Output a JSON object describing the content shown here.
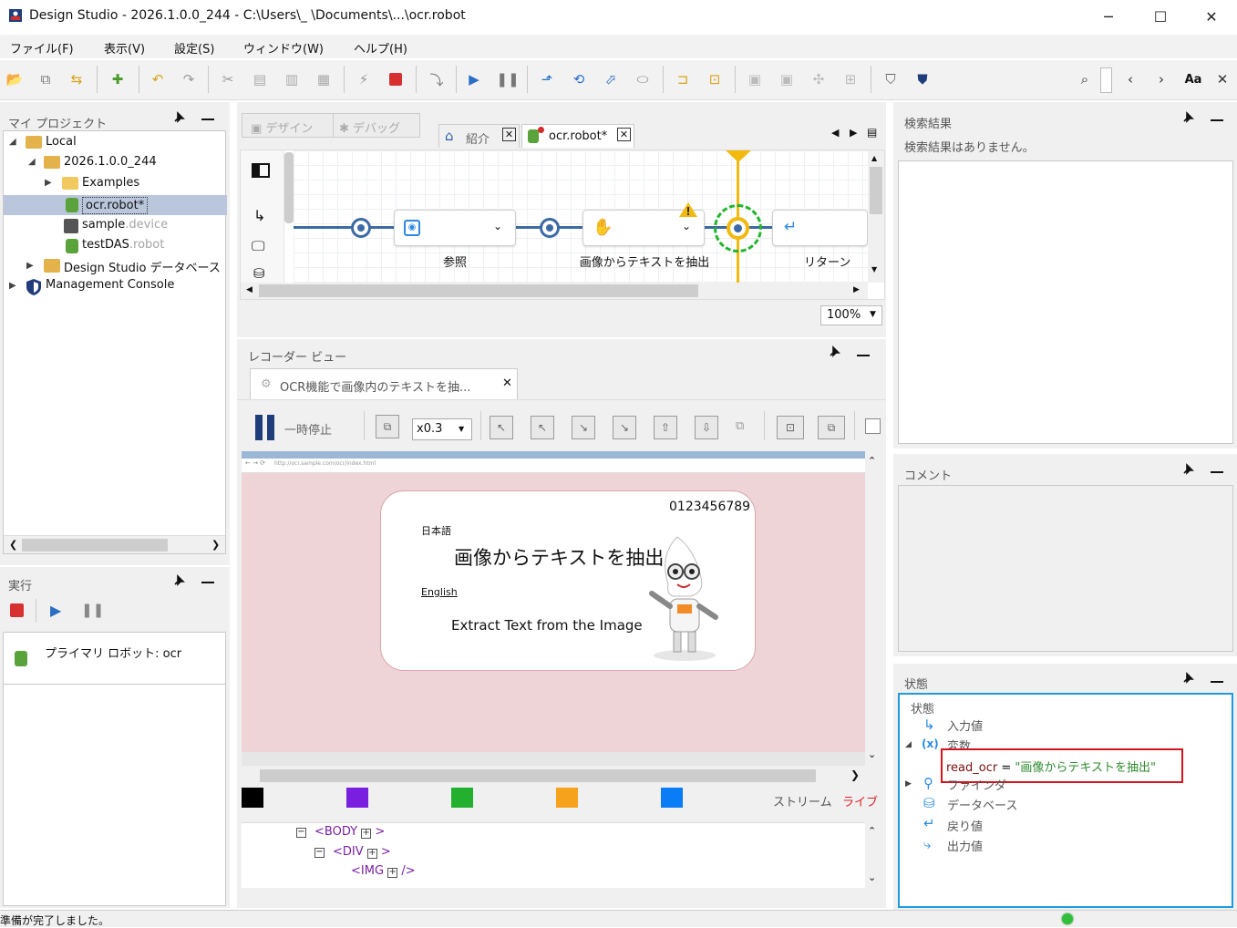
{
  "window": {
    "title": "Design Studio - 2026.1.0.0_244 - C:\\Users\\_        \\Documents\\...\\ocr.robot",
    "minimize": "─",
    "maximize": "☐",
    "close": "✕"
  },
  "menu": [
    "ファイル(F)",
    "表示(V)",
    "設定(S)",
    "ウィンドウ(W)",
    "ヘルプ(H)"
  ],
  "toolbar": {
    "search_value": "",
    "case_label": "Aa"
  },
  "project_panel": {
    "title": "マイ プロジェクト",
    "tree": {
      "local": "Local",
      "version": "2026.1.0.0_244",
      "examples": "Examples",
      "ocr_robot": "ocr.robot*",
      "sample": "sample",
      "sample_ext": ".device",
      "testdas": "testDAS",
      "testdas_ext": ".robot",
      "ds_db": "Design Studio データベース",
      "mc": "Management Console"
    }
  },
  "run_panel": {
    "title": "実行",
    "primary_robot": "プライマリ ロボット: ocr"
  },
  "editor": {
    "mode_tabs": [
      "デザイン",
      "デバッグ"
    ],
    "tabs": [
      "紹介",
      "ocr.robot*"
    ],
    "steps": [
      "参照",
      "画像からテキストを抽出",
      "リターン"
    ],
    "zoom": "100%"
  },
  "recorder": {
    "title": "レコーダー ビュー",
    "tab_label": "OCR機能で画像内のテキストを抽...",
    "pause_label": "一時停止",
    "speed": "x0.3",
    "url": "http://ocr.sample.com/ocr/index.html",
    "card": {
      "number": "0123456789",
      "jp_label": "日本語",
      "jp_text": "画像からテキストを抽出",
      "en_label": "English",
      "en_text": "Extract Text from the Image"
    },
    "stream_label": "ストリーム",
    "live_label": "ライブ",
    "swatches": [
      "#000000",
      "#7a1fe0",
      "#22b02e",
      "#f7a21c",
      "#0a7cf5"
    ],
    "xml": [
      "<BODY",
      ">",
      "<DIV",
      ">",
      "<IMG",
      "/>"
    ]
  },
  "search_panel": {
    "title": "検索結果",
    "empty": "検索結果はありません。"
  },
  "comment_panel": {
    "title": "コメント"
  },
  "state_panel": {
    "title": "状態",
    "root": "状態",
    "input": "入力値",
    "vars": "変数",
    "var_name": "read_ocr",
    "var_eq": " = ",
    "var_value": "\"画像からテキストを抽出\"",
    "finder": "ファインダ",
    "db": "データベース",
    "ret": "戻り値",
    "output": "出力値"
  },
  "status": {
    "text": "準備が完了しました。"
  },
  "colors": {
    "accent_blue": "#3c6aa5",
    "highlight_red": "#d4141b",
    "live_red": "#e0202c",
    "selection": "#b9c6dc",
    "panel_border": "#1e9be0"
  }
}
